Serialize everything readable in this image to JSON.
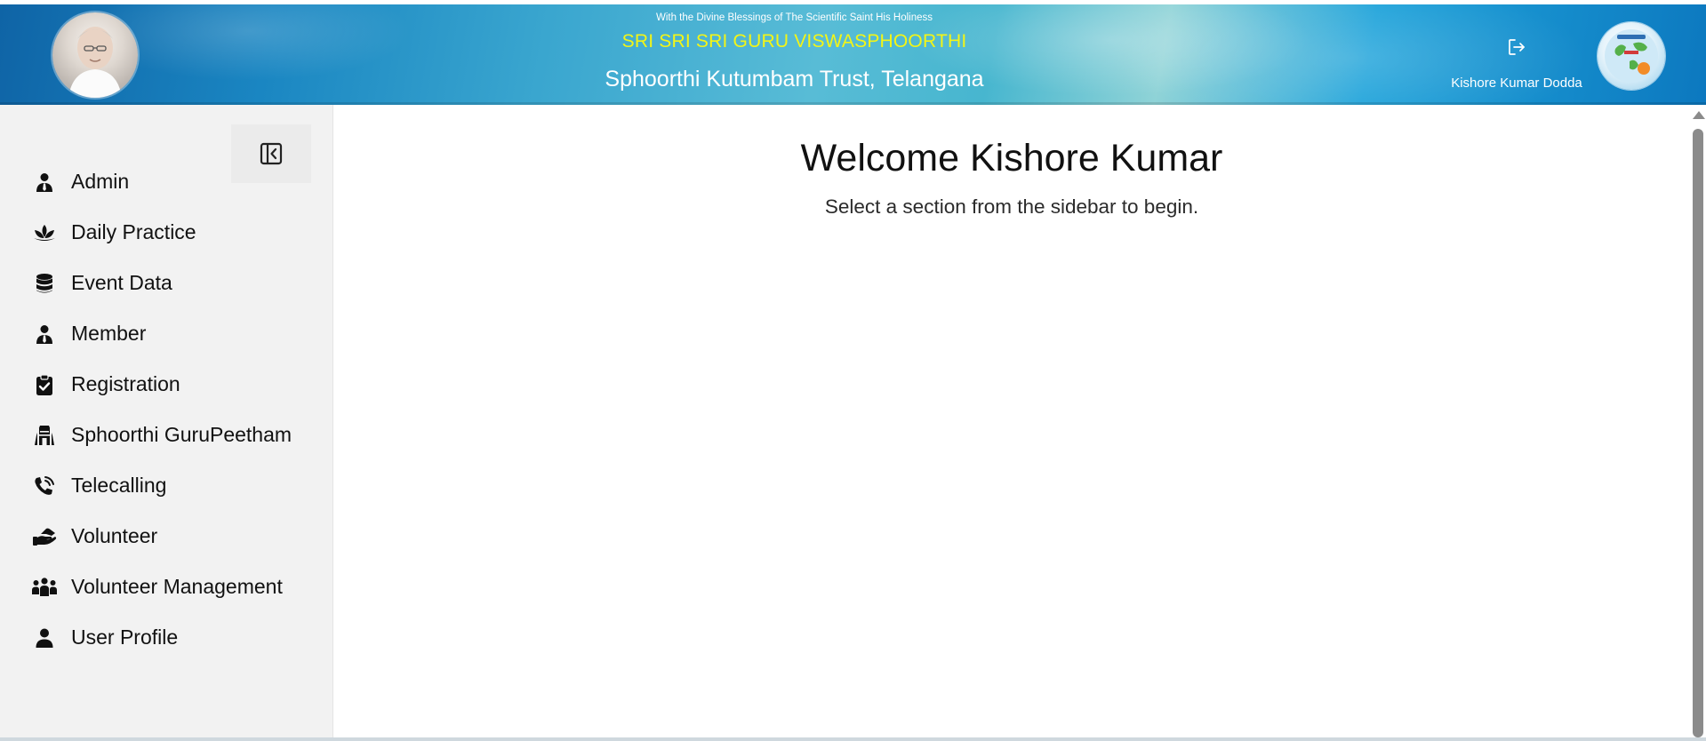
{
  "header": {
    "blessing_text": "With the Divine Blessings of The Scientific Saint His Holiness",
    "guru_name": "SRI SRI SRI GURU VISWASPHOORTHI",
    "trust_name": "Sphoorthi Kutumbam Trust, Telangana",
    "user_name": "Kishore Kumar Dodda",
    "logout_icon": "logout-icon",
    "guru_name_color": "#f3f516"
  },
  "sidebar": {
    "collapse_icon": "collapse-sidebar-icon",
    "items": [
      {
        "label": "Admin",
        "icon": "user-tie-icon"
      },
      {
        "label": "Daily Practice",
        "icon": "lotus-icon"
      },
      {
        "label": "Event Data",
        "icon": "database-icon"
      },
      {
        "label": "Member",
        "icon": "user-tie-icon"
      },
      {
        "label": "Registration",
        "icon": "clipboard-check-icon"
      },
      {
        "label": "Sphoorthi GuruPeetham",
        "icon": "temple-icon"
      },
      {
        "label": "Telecalling",
        "icon": "phone-volume-icon"
      },
      {
        "label": "Volunteer",
        "icon": "hands-helping-icon"
      },
      {
        "label": "Volunteer Management",
        "icon": "people-group-icon"
      },
      {
        "label": "User Profile",
        "icon": "user-icon"
      }
    ]
  },
  "main": {
    "welcome_title": "Welcome Kishore Kumar",
    "welcome_subtitle": "Select a section from the sidebar to begin."
  }
}
